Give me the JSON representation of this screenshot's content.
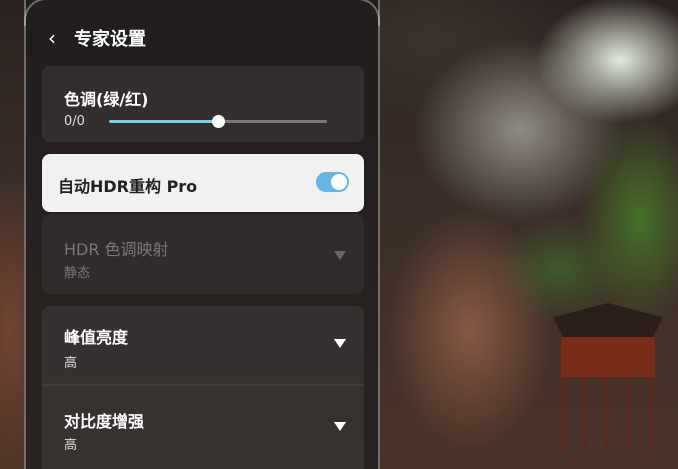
{
  "header": {
    "title": "专家设置"
  },
  "tone": {
    "label": "色调(绿/红)",
    "value": "0/0",
    "slider_fraction": 0.5
  },
  "hdr_rebuild": {
    "label": "自动HDR重构 Pro",
    "enabled": true
  },
  "hdr_mapping": {
    "label": "HDR 色调映射",
    "value": "静态"
  },
  "peak_brightness": {
    "label": "峰值亮度",
    "value": "高"
  },
  "contrast_enhance": {
    "label": "对比度增强",
    "value": "高"
  },
  "colors": {
    "accent": "#63b7e3",
    "slider": "#6fd3f0"
  }
}
